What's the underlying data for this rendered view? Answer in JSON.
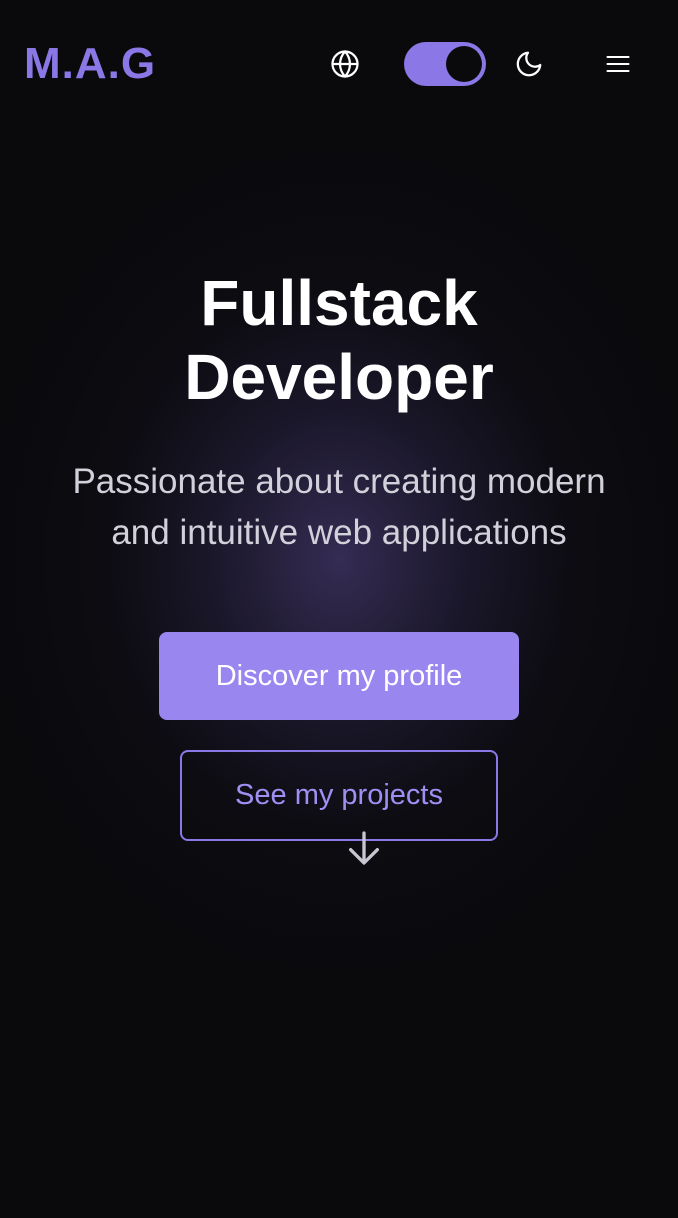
{
  "header": {
    "logo": "M.A.G",
    "icons": {
      "language": "globe-icon",
      "theme_toggle": "toggle-switch",
      "theme": "moon-icon",
      "menu": "hamburger-menu-icon"
    },
    "theme_toggle_on": true
  },
  "hero": {
    "title_line1": "Fullstack",
    "title_line2": "Developer",
    "subtitle_line1": "Passionate about creating modern",
    "subtitle_line2": "and intuitive web applications",
    "primary_button": "Discover my profile",
    "secondary_button": "See my projects",
    "scroll_icon": "arrow-down-icon"
  },
  "colors": {
    "background": "#0a0a0d",
    "accent": "#8b78e6",
    "primary_button": "#9a86ef",
    "text": "#ffffff",
    "subtitle": "#d2d0da"
  }
}
